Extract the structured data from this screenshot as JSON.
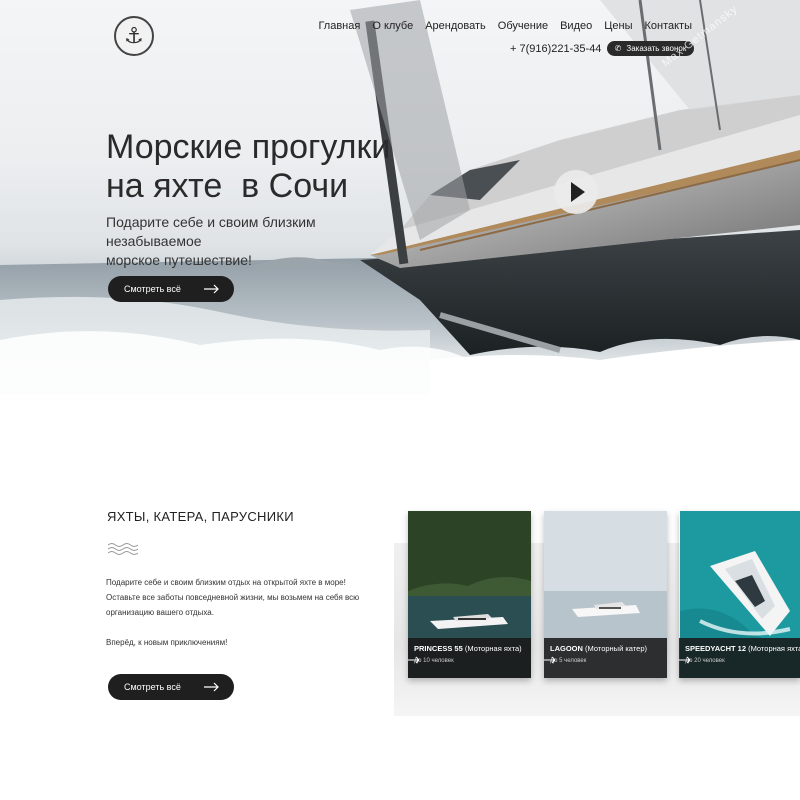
{
  "header": {
    "logo_icon": "anchor-icon",
    "nav": [
      "Главная",
      "О клубе",
      "Арендовать",
      "Обучение",
      "Видео",
      "Цены",
      "Контакты"
    ],
    "phone": "+ 7(916)221-35-44",
    "callback_label": "Заказать звонок",
    "callback_icon": "phone-icon"
  },
  "hero": {
    "title_line1": "Морские прогулки",
    "title_line2": "на яхте  в Сочи",
    "subtitle_line1": "Подарите себе и своим близким незабываемое",
    "subtitle_line2": "морское путешествие!",
    "button_label": "Смотреть всё",
    "play_icon": "play-icon",
    "watermark": "Max Getmansky"
  },
  "section": {
    "title": "ЯХТЫ, КАТЕРА, ПАРУСНИКИ",
    "paragraph1_line1": "Подарите себе и своим близким отдых на открытой яхте в море!",
    "paragraph1_line2": "Оставьте все заботы повседневной жизни, мы возьмем на себя всю",
    "paragraph1_line3": "организацию вашего отдыха.",
    "paragraph2": "Вперёд, к новым приключениям!",
    "button_label": "Смотреть всё"
  },
  "cards": [
    {
      "name": "PRINCESS 55",
      "type": "(Моторная яхта)",
      "capacity": "До 10 человек"
    },
    {
      "name": "LAGOON",
      "type": "(Моторный катер)",
      "capacity": "До 5 человек"
    },
    {
      "name": "SPEEDYACHT 12",
      "type": "(Моторная яхта)",
      "capacity": "До 20 человек"
    }
  ],
  "colors": {
    "accent": "#1f1f1f",
    "text": "#222222",
    "sea_turquoise": "#1fa3a8"
  }
}
